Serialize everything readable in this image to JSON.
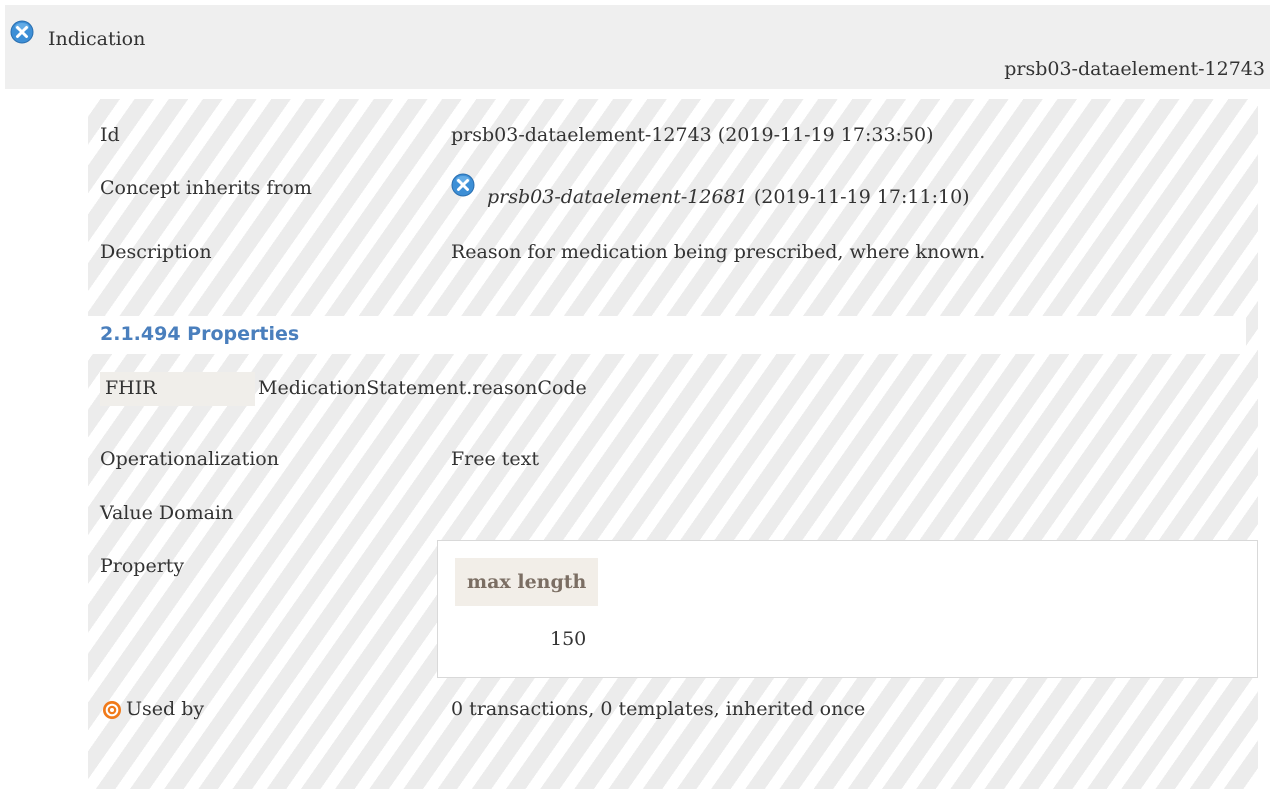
{
  "header": {
    "title": "Indication",
    "id": "prsb03-dataelement-12743",
    "icon": "concept-icon"
  },
  "rows": {
    "id_label": "Id",
    "id_value": "prsb03-dataelement-12743 (2019-11-19 17:33:50)",
    "inherits_label": "Concept inherits from",
    "inherits_link": "prsb03-dataelement-12681",
    "inherits_date": " (2019-11-19 17:11:10)",
    "description_label": "Description",
    "description_value": "Reason for medication being prescribed, where known."
  },
  "properties": {
    "title": "2.1.494 Properties",
    "fhir_label": "FHIR",
    "fhir_value": "MedicationStatement.reasonCode"
  },
  "operationalization": {
    "label": "Operationalization",
    "value": "Free text"
  },
  "value_domain": {
    "label": "Value Domain"
  },
  "property": {
    "label": "Property",
    "header": "max length",
    "value": "150"
  },
  "used_by": {
    "label": "Used by",
    "value": "0 transactions, 0 templates, inherited once",
    "icon": "target-icon"
  },
  "colors": {
    "accent": "#4a7fbd",
    "icon_blue": "#3d8fd6",
    "icon_orange": "#f07a1a"
  }
}
